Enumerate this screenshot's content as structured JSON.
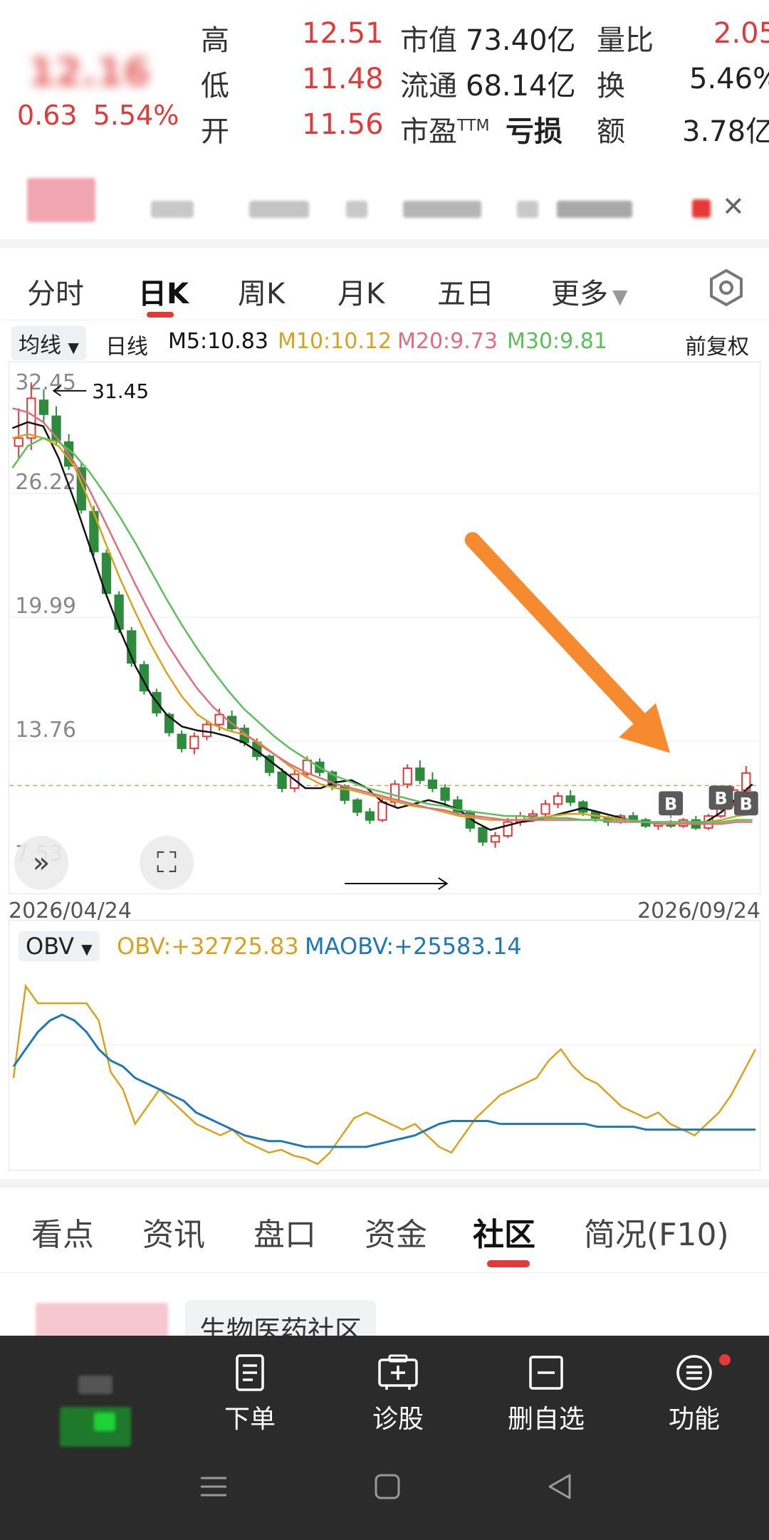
{
  "quote": {
    "price": "12.16",
    "change": "0.63",
    "change_pct": "5.54%",
    "stats": [
      {
        "label": "高",
        "value": "12.51"
      },
      {
        "label": "低",
        "value": "11.48"
      },
      {
        "label": "开",
        "value": "11.56"
      },
      {
        "label": "市值",
        "value": "73.40亿"
      },
      {
        "label": "流通",
        "value": "68.14亿"
      },
      {
        "label": "市盈",
        "sup": "TTM",
        "value": "亏损"
      },
      {
        "label": "量比",
        "value": "2.05"
      },
      {
        "label": "换",
        "value": "5.46%"
      },
      {
        "label": "额",
        "value": "3.78亿"
      }
    ],
    "close_icon": "close-icon"
  },
  "tabs": {
    "items": [
      "分时",
      "日K",
      "周K",
      "月K",
      "五日",
      "更多"
    ],
    "active_index": 1,
    "settings_icon": "hexagon-gear-icon"
  },
  "ma_legend": {
    "dropdown": "均线",
    "period": "日线",
    "m5": "M5:10.83",
    "m10": "M10:10.12",
    "m20": "M20:9.73",
    "m30": "M30:9.81",
    "adjust": "前复权"
  },
  "colors": {
    "up": "#e03a3a",
    "down": "#2e8b3d",
    "m5": "#111111",
    "m10": "#d9a21e",
    "m20": "#dd6f7e",
    "m30": "#5cc05a",
    "obv": "#d9a21e",
    "maobv": "#1f77b4",
    "arrow": "#f58a2e"
  },
  "chart_data": [
    {
      "type": "candlestick",
      "y_ticks": [
        "32.45",
        "26.22",
        "19.99",
        "13.76",
        "7.53"
      ],
      "y_range": [
        7.53,
        32.45
      ],
      "max_label": "31.45",
      "x_start": "2026/04/24",
      "x_end": "2026/09/24",
      "reference_price": 11.53,
      "ohlc": [
        [
          28.6,
          30.5,
          28.0,
          29.0
        ],
        [
          29.0,
          31.8,
          28.4,
          31.0
        ],
        [
          30.9,
          31.45,
          29.8,
          30.2
        ],
        [
          30.1,
          30.6,
          28.6,
          28.9
        ],
        [
          28.8,
          29.2,
          27.4,
          27.6
        ],
        [
          27.5,
          27.8,
          25.2,
          25.4
        ],
        [
          25.3,
          25.6,
          23.1,
          23.3
        ],
        [
          23.2,
          23.4,
          21.0,
          21.2
        ],
        [
          21.1,
          21.3,
          19.2,
          19.4
        ],
        [
          19.3,
          19.5,
          17.5,
          17.7
        ],
        [
          17.6,
          17.8,
          16.1,
          16.3
        ],
        [
          16.2,
          16.4,
          15.0,
          15.2
        ],
        [
          15.1,
          15.2,
          14.0,
          14.2
        ],
        [
          14.1,
          14.3,
          13.2,
          13.4
        ],
        [
          13.4,
          14.2,
          13.1,
          14.0
        ],
        [
          14.0,
          14.8,
          13.8,
          14.6
        ],
        [
          14.6,
          15.4,
          14.3,
          15.1
        ],
        [
          15.0,
          15.3,
          14.2,
          14.4
        ],
        [
          14.4,
          14.6,
          13.5,
          13.7
        ],
        [
          13.7,
          13.9,
          12.8,
          13.0
        ],
        [
          13.0,
          13.1,
          12.0,
          12.2
        ],
        [
          12.2,
          12.4,
          11.2,
          11.4
        ],
        [
          11.4,
          12.3,
          11.2,
          12.1
        ],
        [
          12.1,
          13.0,
          11.9,
          12.8
        ],
        [
          12.7,
          12.9,
          12.0,
          12.2
        ],
        [
          12.2,
          12.3,
          11.3,
          11.5
        ],
        [
          11.5,
          11.6,
          10.6,
          10.8
        ],
        [
          10.8,
          10.9,
          10.0,
          10.2
        ],
        [
          10.2,
          10.4,
          9.6,
          9.8
        ],
        [
          9.8,
          10.9,
          9.7,
          10.7
        ],
        [
          10.7,
          11.8,
          10.5,
          11.6
        ],
        [
          11.6,
          12.6,
          11.4,
          12.4
        ],
        [
          12.4,
          12.8,
          11.6,
          11.8
        ],
        [
          11.8,
          12.2,
          11.2,
          11.4
        ],
        [
          11.4,
          11.6,
          10.6,
          10.8
        ],
        [
          10.8,
          11.0,
          10.0,
          10.2
        ],
        [
          10.2,
          10.3,
          9.2,
          9.4
        ],
        [
          9.4,
          9.5,
          8.5,
          8.7
        ],
        [
          8.7,
          9.2,
          8.4,
          9.0
        ],
        [
          9.0,
          9.9,
          8.9,
          9.7
        ],
        [
          9.7,
          10.2,
          9.5,
          10.0
        ],
        [
          10.0,
          10.3,
          9.7,
          10.1
        ],
        [
          10.1,
          10.8,
          9.9,
          10.6
        ],
        [
          10.6,
          11.2,
          10.4,
          11.0
        ],
        [
          11.0,
          11.3,
          10.5,
          10.7
        ],
        [
          10.7,
          10.8,
          10.0,
          10.2
        ],
        [
          10.2,
          10.3,
          9.7,
          9.9
        ],
        [
          9.9,
          10.0,
          9.5,
          9.7
        ],
        [
          9.7,
          10.1,
          9.6,
          10.0
        ],
        [
          10.0,
          10.2,
          9.7,
          9.8
        ],
        [
          9.8,
          9.9,
          9.4,
          9.5
        ],
        [
          9.5,
          9.7,
          9.3,
          9.6
        ],
        [
          9.6,
          9.8,
          9.4,
          9.5
        ],
        [
          9.5,
          9.9,
          9.4,
          9.8
        ],
        [
          9.8,
          10.0,
          9.3,
          9.4
        ],
        [
          9.4,
          10.1,
          9.3,
          10.0
        ],
        [
          10.0,
          10.9,
          9.9,
          10.7
        ],
        [
          10.7,
          11.5,
          10.5,
          11.3
        ],
        [
          11.3,
          12.51,
          11.1,
          12.16
        ]
      ],
      "ma": {
        "M5": [
          29.5,
          29.8,
          29.6,
          28.0,
          25.9,
          23.6,
          21.3,
          19.3,
          17.5,
          16.1,
          15.1,
          14.5,
          14.3,
          14.2,
          14.0,
          13.7,
          13.2,
          12.6,
          12.0,
          11.4,
          11.4,
          11.7,
          11.8,
          11.4,
          10.7,
          10.4,
          10.6,
          10.8,
          10.6,
          10.3,
          9.7,
          9.3,
          9.5,
          9.7,
          9.8,
          10.0,
          10.2,
          10.4,
          10.2,
          10.0,
          9.8,
          9.7,
          9.6,
          9.6,
          9.6,
          9.7,
          10.2,
          10.9,
          11.6
        ],
        "M10": [
          29.0,
          29.2,
          29.0,
          28.6,
          27.6,
          25.8,
          23.8,
          21.9,
          20.2,
          18.6,
          17.2,
          16.0,
          15.1,
          14.6,
          14.3,
          14.1,
          13.7,
          13.1,
          12.5,
          12.0,
          11.6,
          11.4,
          11.3,
          11.1,
          10.9,
          10.7,
          10.5,
          10.4,
          10.2,
          10.0,
          9.9,
          9.8,
          9.8,
          9.8,
          9.9,
          10.0,
          10.1,
          10.1,
          10.0,
          9.9,
          9.8,
          9.7,
          9.7,
          9.7,
          9.7,
          9.7,
          9.8,
          10.0,
          10.1
        ],
        "M20": [
          30.5,
          30.3,
          29.8,
          28.9,
          27.8,
          26.4,
          24.8,
          23.2,
          21.6,
          20.1,
          18.7,
          17.5,
          16.4,
          15.5,
          14.8,
          14.2,
          13.6,
          13.1,
          12.6,
          12.2,
          11.9,
          11.6,
          11.4,
          11.2,
          11.0,
          10.8,
          10.6,
          10.4,
          10.3,
          10.1,
          10.0,
          9.9,
          9.8,
          9.8,
          9.8,
          9.8,
          9.8,
          9.8,
          9.8,
          9.7,
          9.7,
          9.7,
          9.6,
          9.6,
          9.6,
          9.6,
          9.6,
          9.7,
          9.7
        ],
        "M30": [
          27.5,
          28.6,
          29.0,
          28.8,
          28.2,
          27.3,
          26.2,
          25.0,
          23.7,
          22.3,
          20.9,
          19.6,
          18.4,
          17.3,
          16.3,
          15.4,
          14.7,
          14.0,
          13.4,
          12.9,
          12.4,
          12.0,
          11.7,
          11.4,
          11.2,
          11.0,
          10.8,
          10.6,
          10.5,
          10.3,
          10.2,
          10.1,
          10.0,
          10.0,
          9.9,
          9.9,
          9.9,
          9.8,
          9.8,
          9.8,
          9.8,
          9.7,
          9.7,
          9.7,
          9.7,
          9.7,
          9.7,
          9.8,
          9.8
        ]
      },
      "annotations": [
        {
          "label": "B"
        },
        {
          "label": "B"
        },
        {
          "label": "B"
        }
      ]
    },
    {
      "type": "line",
      "indicator": "OBV",
      "obv_label": "OBV:+32725.83",
      "maobv_label": "MAOBV:+25583.14",
      "series": [
        {
          "name": "OBV",
          "values": [
            30,
            62,
            56,
            56,
            56,
            56,
            56,
            50,
            32,
            26,
            14,
            20,
            26,
            22,
            18,
            14,
            12,
            10,
            12,
            8,
            6,
            4,
            5,
            3,
            2,
            0,
            4,
            10,
            16,
            18,
            16,
            14,
            12,
            14,
            10,
            6,
            4,
            10,
            16,
            20,
            24,
            26,
            28,
            30,
            36,
            40,
            34,
            30,
            28,
            24,
            20,
            18,
            16,
            18,
            14,
            12,
            10,
            14,
            18,
            24,
            32,
            40
          ]
        },
        {
          "name": "MAOBV",
          "values": [
            34,
            40,
            46,
            50,
            52,
            50,
            46,
            40,
            36,
            34,
            30,
            28,
            26,
            24,
            22,
            18,
            16,
            14,
            12,
            10,
            9,
            8,
            8,
            7,
            6,
            6,
            6,
            6,
            6,
            6,
            7,
            8,
            9,
            10,
            12,
            14,
            15,
            15,
            15,
            15,
            14,
            14,
            14,
            14,
            14,
            14,
            14,
            14,
            13,
            13,
            13,
            13,
            12,
            12,
            12,
            12,
            12,
            12,
            12,
            12,
            12,
            12
          ]
        }
      ],
      "y_range": [
        0,
        70
      ]
    }
  ],
  "info_tabs": {
    "items": [
      "看点",
      "资讯",
      "盘口",
      "资金",
      "社区",
      "简况(F10)"
    ],
    "active_index": 4
  },
  "community": {
    "chip": "生物医药社区"
  },
  "actionbar": {
    "items": [
      {
        "label": "下单",
        "icon": "order-document-icon"
      },
      {
        "label": "诊股",
        "icon": "diagnose-plus-icon"
      },
      {
        "label": "删自选",
        "icon": "remove-watchlist-icon"
      },
      {
        "label": "功能",
        "icon": "menu-circle-icon"
      }
    ]
  },
  "system_nav": {
    "menu_icon": "menu-lines-icon",
    "home_icon": "home-square-icon",
    "back_icon": "back-triangle-icon"
  }
}
